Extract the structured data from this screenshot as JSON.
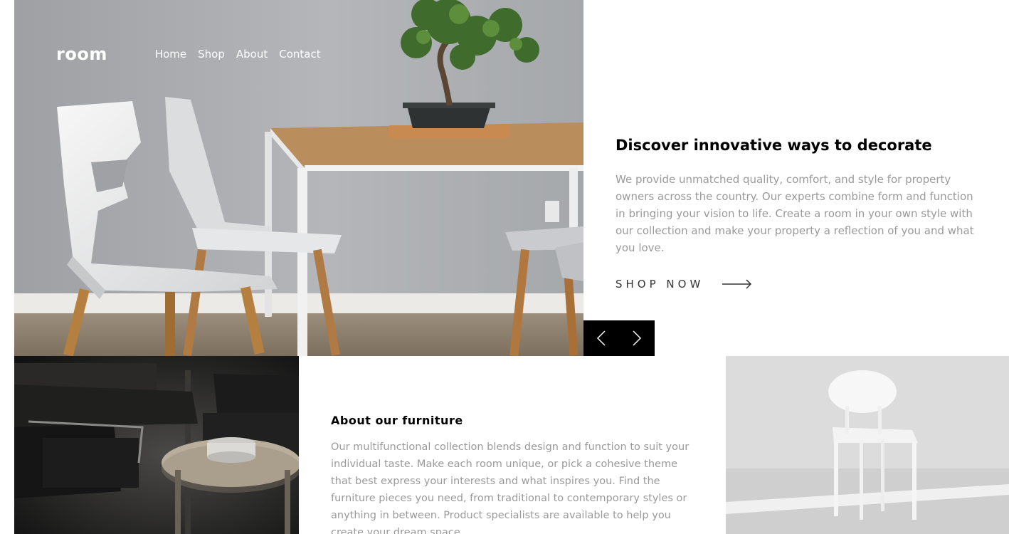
{
  "brand": {
    "logo": "room"
  },
  "nav": {
    "items": [
      "Home",
      "Shop",
      "About",
      "Contact"
    ]
  },
  "hero": {
    "title": "Discover innovative ways to decorate",
    "description": "We provide unmatched quality, comfort, and style for property owners across the country. Our experts combine form and function in bringing your vision to life. Create a room in your own style with our collection and make your property a reflection of you and what you love.",
    "cta_label": "SHOP NOW",
    "cta_icon": "arrow-right-icon"
  },
  "slider": {
    "prev_icon": "chevron-left-icon",
    "next_icon": "chevron-right-icon"
  },
  "about": {
    "title": "About our furniture",
    "description": "Our multifunctional collection blends design and function to suit your individual taste. Make each room unique, or pick a cohesive theme that best express your interests and what inspires you. Find the furniture pieces you need, from traditional to contemporary styles or anything in between. Product specialists are available to help you create your dream space."
  },
  "colors": {
    "text_dark": "#000000",
    "text_muted": "#9a9a9a",
    "slider_bg": "#000000",
    "nav_text": "#ffffff"
  }
}
